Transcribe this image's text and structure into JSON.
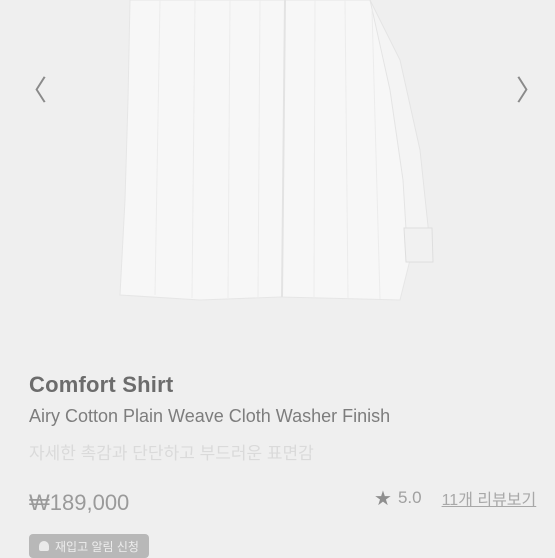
{
  "gallery": {
    "prev_icon": "chevron-left-icon",
    "next_icon": "chevron-right-icon",
    "prev_glyph": "〈",
    "next_glyph": "〉"
  },
  "product": {
    "name": "Comfort Shirt",
    "subtitle": "Airy Cotton Plain Weave Cloth Washer Finish",
    "description": "자세한 촉감과 단단하고 부드러운 표면감",
    "price": "₩189,000",
    "rating": "5.0",
    "reviews_link": "11개 리뷰보기",
    "badge": "재입고 알림 신청"
  },
  "colors": {
    "background": "#efefef",
    "title": "#6c6c6c"
  }
}
